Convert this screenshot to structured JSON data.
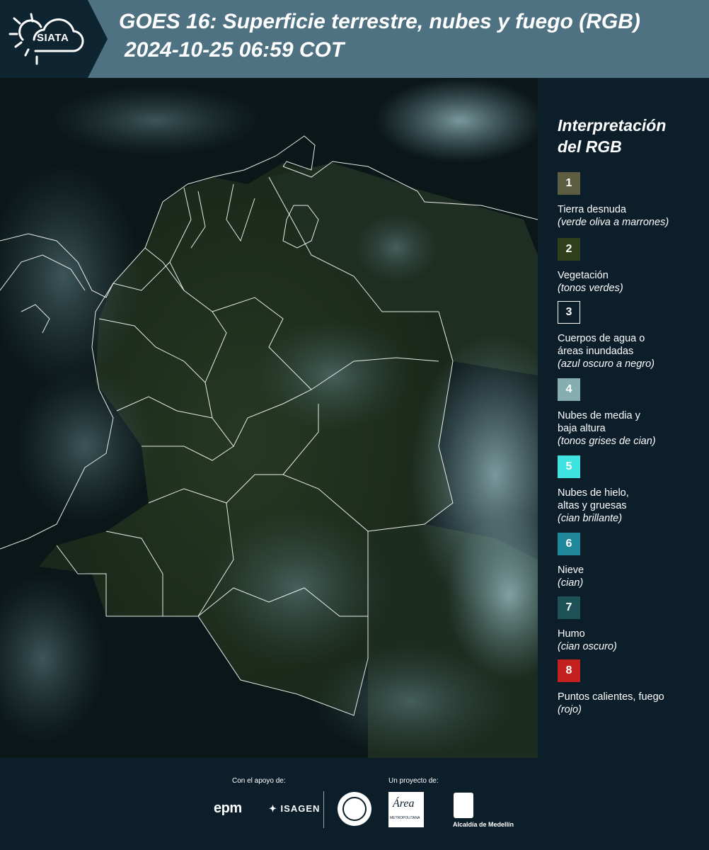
{
  "header": {
    "logo_text": "SIATA",
    "title_line1": "GOES 16: Superficie terrestre, nubes y fuego (RGB)",
    "title_line2": "2024-10-25 06:59 COT"
  },
  "legend": {
    "title_line1": "Interpretación",
    "title_line2": "del RGB",
    "items": [
      {
        "num": "1",
        "color": "#5d5d42",
        "label": "Tierra desnuda",
        "desc": "(verde oliva a marrones)"
      },
      {
        "num": "2",
        "color": "#2f3f1c",
        "label": "Vegetación",
        "desc": "(tonos verdes)"
      },
      {
        "num": "3",
        "color": "#0c1e2a",
        "label": "Cuerpos de agua o\náreas inundadas",
        "desc": "(azul oscuro a negro)"
      },
      {
        "num": "4",
        "color": "#86aeb0",
        "label": "Nubes de media y\nbaja altura",
        "desc": "(tonos grises de cian)"
      },
      {
        "num": "5",
        "color": "#3ee3e0",
        "label": "Nubes de hielo,\naltas y gruesas",
        "desc": "(cian brillante)"
      },
      {
        "num": "6",
        "color": "#21879a",
        "label": "Nieve",
        "desc": "(cian)"
      },
      {
        "num": "7",
        "color": "#1d5057",
        "label": "Humo",
        "desc": "(cian oscuro)"
      },
      {
        "num": "8",
        "color": "#c4201f",
        "label": "Puntos calientes, fuego",
        "desc": "(rojo)"
      }
    ]
  },
  "footer": {
    "support_label": "Con el apoyo de:",
    "project_label": "Un proyecto de:",
    "epm": "epm",
    "isagen": "ISAGEN",
    "area_logo": "Área",
    "area_sub": "METROPOLITANA",
    "medellin": "Alcaldía de Medellín"
  }
}
